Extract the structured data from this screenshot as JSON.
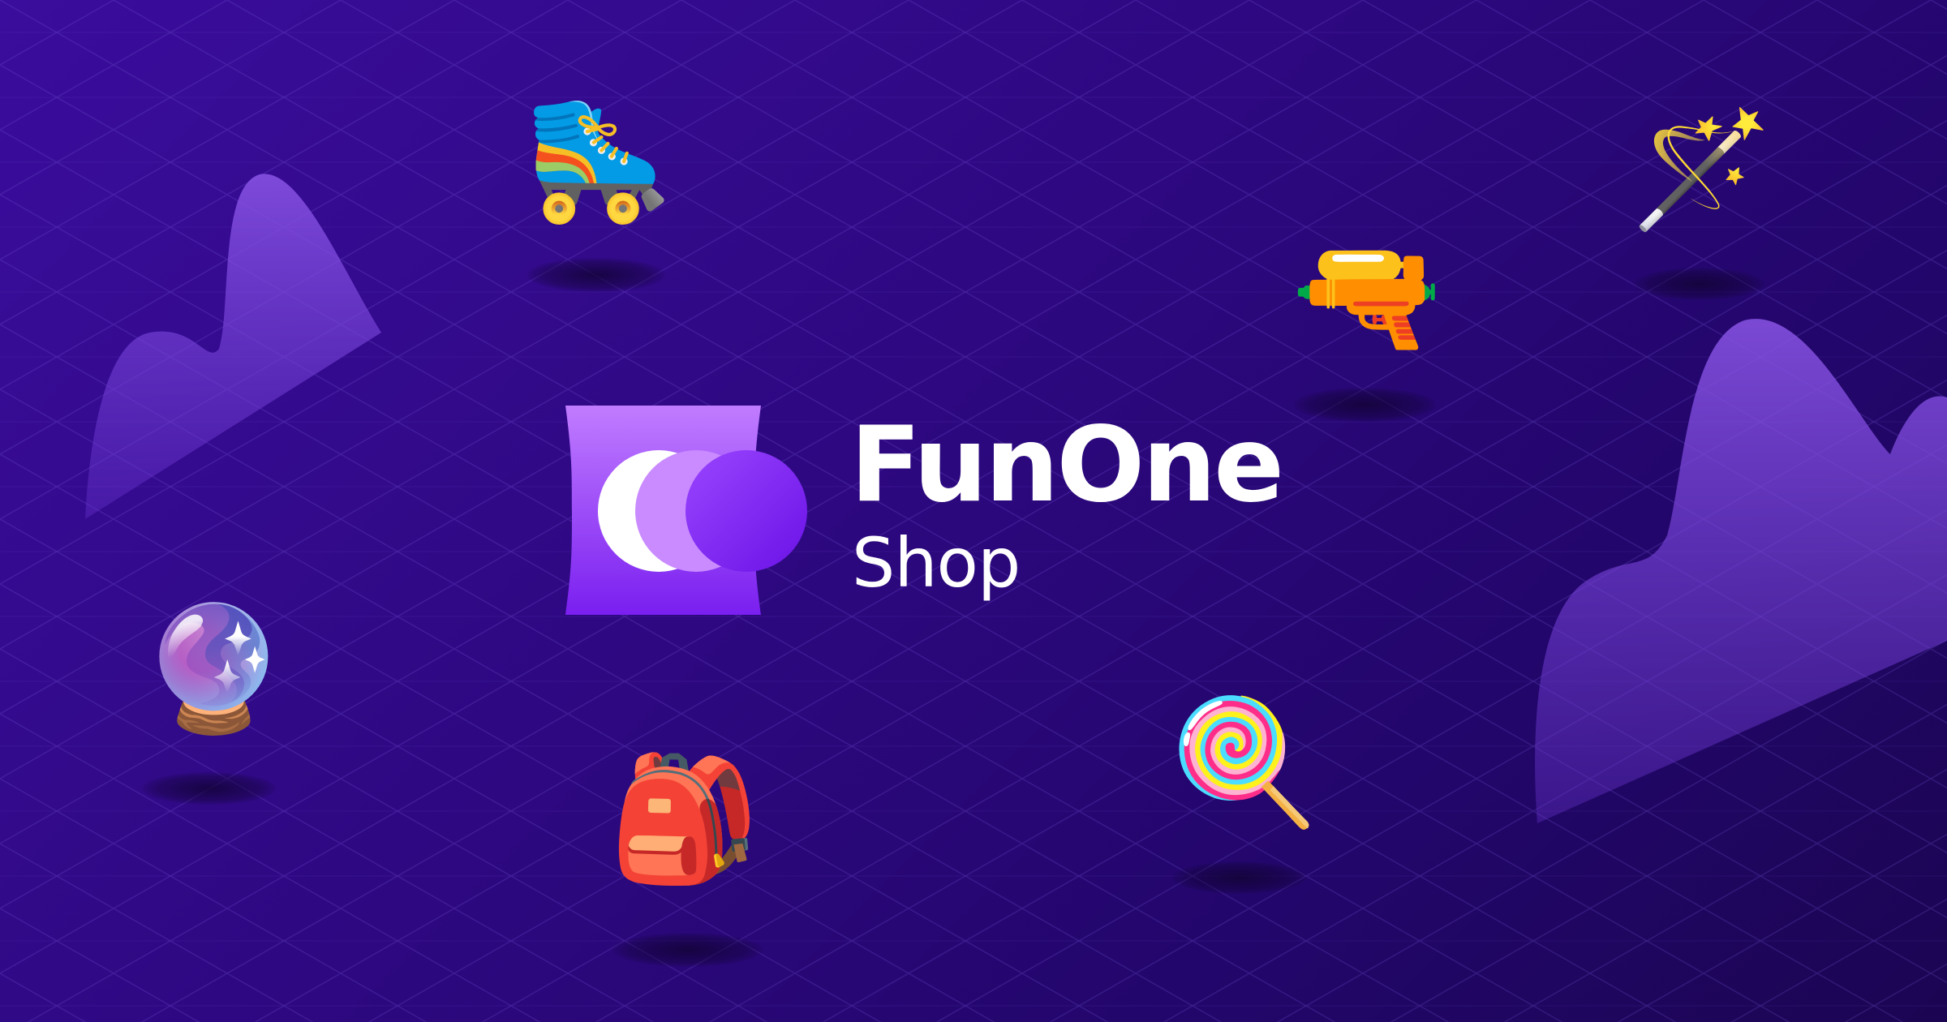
{
  "brand": {
    "name": "FunOne",
    "subtitle": "Shop"
  },
  "colors": {
    "background": "#2d0880",
    "logo_gradient_top": "#c07cff",
    "logo_gradient_bottom": "#7a1ff0",
    "accent": "#8b3cff",
    "grid": "#6a4bd0"
  },
  "icons": [
    {
      "name": "roller-skate-icon",
      "glyph": "🛼"
    },
    {
      "name": "magic-wand-icon",
      "glyph": "🪄"
    },
    {
      "name": "water-pistol-icon",
      "glyph": "🔫"
    },
    {
      "name": "crystal-ball-icon",
      "glyph": "🔮"
    },
    {
      "name": "backpack-icon",
      "glyph": "🎒"
    },
    {
      "name": "lollipop-icon",
      "glyph": "🍭"
    }
  ]
}
